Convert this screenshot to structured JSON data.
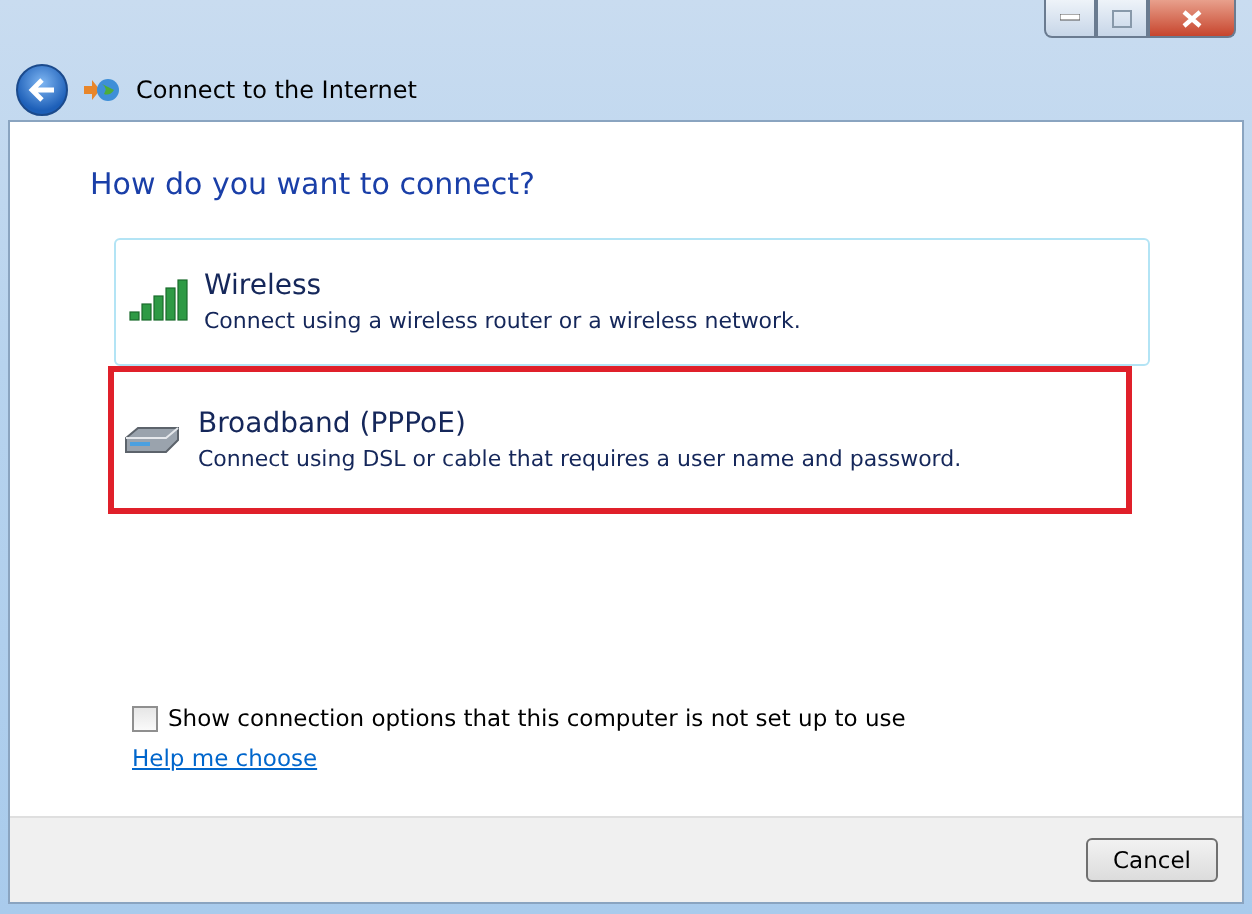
{
  "window": {
    "title": "Connect to the Internet"
  },
  "heading": "How do you want to connect?",
  "options": [
    {
      "kind": "wireless",
      "title": "Wireless",
      "description": "Connect using a wireless router or a wireless network.",
      "hovered": true,
      "highlighted": false
    },
    {
      "kind": "broadband",
      "title": "Broadband (PPPoE)",
      "description": "Connect using DSL or cable that requires a user name and password.",
      "hovered": false,
      "highlighted": true
    }
  ],
  "show_all_checkbox": {
    "label": "Show connection options that this computer is not set up to use",
    "checked": false
  },
  "help_link": "Help me choose",
  "buttons": [
    "Cancel"
  ]
}
